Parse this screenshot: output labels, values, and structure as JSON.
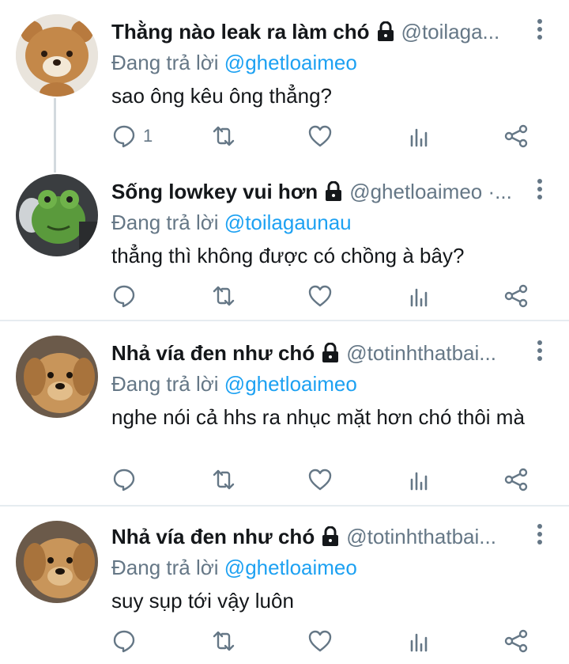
{
  "tweets": [
    {
      "name": "Thằng nào leak ra làm chó",
      "handle": "@toilaga...",
      "reply_prefix": "Đang trả lời",
      "reply_to": "@ghetloaimeo",
      "text": "sao ông kêu ông thẳng?",
      "reply_count": "1",
      "avatar": "bear-plush-avatar"
    },
    {
      "name": "Sống lowkey vui hơn",
      "handle": "@ghetloaimeo ·...",
      "reply_prefix": "Đang trả lời",
      "reply_to": "@toilagaunau",
      "text": "thẳng thì không được có chồng à bây?",
      "reply_count": "",
      "avatar": "frog-plush-avatar"
    },
    {
      "name": "Nhả vía đen như chó",
      "handle": "@totinhthatbai...",
      "reply_prefix": "Đang trả lời",
      "reply_to": "@ghetloaimeo",
      "text": "nghe nói cả hhs ra nhục mặt hơn chó thôi mà",
      "reply_count": "",
      "avatar": "golden-puppy-avatar"
    },
    {
      "name": "Nhả vía đen như chó",
      "handle": "@totinhthatbai...",
      "reply_prefix": "Đang trả lời",
      "reply_to": "@ghetloaimeo",
      "text": "suy sụp tới vậy luôn",
      "reply_count": "",
      "avatar": "golden-puppy-avatar"
    }
  ],
  "colors": {
    "accent": "#1da1f2",
    "secondary_text": "#657786",
    "primary_text": "#14171a",
    "divider": "#e6ecf0"
  },
  "icons": [
    "more-vertical-icon",
    "lock-icon",
    "reply-icon",
    "retweet-icon",
    "like-icon",
    "analytics-icon",
    "share-icon"
  ]
}
